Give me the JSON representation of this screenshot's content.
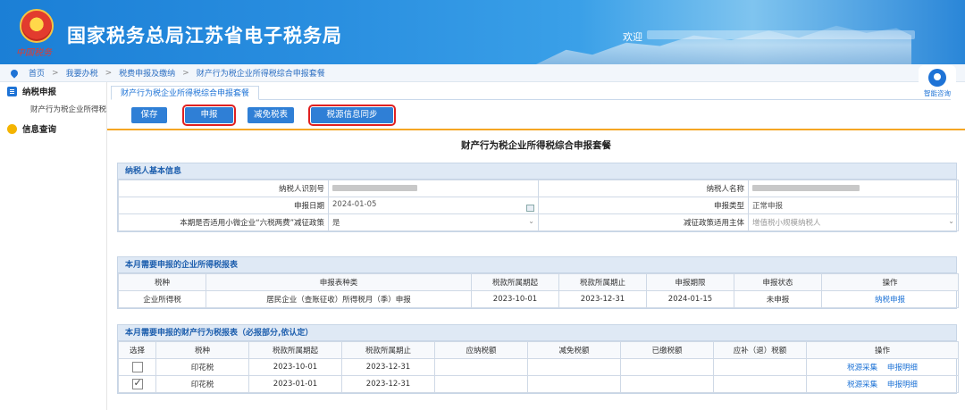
{
  "header": {
    "site_title": "国家税务总局江苏省电子税务局",
    "emblem_text": "中国税务",
    "welcome": "欢迎"
  },
  "breadcrumb": [
    "首页",
    "我要办税",
    "税费申报及缴纳",
    "财产行为税企业所得税综合申报套餐"
  ],
  "sidebar": {
    "group1": "纳税申报",
    "item1": "财产行为税企业所得税",
    "group2": "信息查询"
  },
  "help": {
    "label": "智能咨询"
  },
  "tab": {
    "label": "财产行为税企业所得税综合申报套餐"
  },
  "toolbar": {
    "save": "保存",
    "declare": "申报",
    "reduce": "减免税表",
    "sync": "税源信息同步"
  },
  "main_title": "财产行为税企业所得税综合申报套餐",
  "taxpayer": {
    "section": "纳税人基本信息",
    "id_label": "纳税人识别号",
    "name_label": "纳税人名称",
    "date_label": "申报日期",
    "date_value": "2024-01-05",
    "type_label": "申报类型",
    "type_value": "正常申报",
    "policy_label": "本期是否适用小微企业“六税两费”减征政策",
    "policy_value": "是",
    "subject_label": "减征政策适用主体",
    "subject_value": "增值税小规模纳税人"
  },
  "cit": {
    "section": "本月需要申报的企业所得税报表",
    "headers": [
      "税种",
      "申报表种类",
      "税款所属期起",
      "税款所属期止",
      "申报期限",
      "申报状态",
      "操作"
    ],
    "row": {
      "tax": "企业所得税",
      "form": "居民企业（查账征收）所得税月（季）申报",
      "from": "2023-10-01",
      "to": "2023-12-31",
      "deadline": "2024-01-15",
      "status": "未申报",
      "action": "纳税申报"
    }
  },
  "ppt": {
    "section": "本月需要申报的财产行为税报表（必报部分,依认定）",
    "headers": [
      "选择",
      "税种",
      "税款所属期起",
      "税款所属期止",
      "应纳税额",
      "减免税额",
      "已缴税额",
      "应补（退）税额",
      "操作"
    ],
    "rows": [
      {
        "tax": "印花税",
        "from": "2023-10-01",
        "to": "2023-12-31",
        "checked": false,
        "action1": "税源采集",
        "action2": "申报明细"
      },
      {
        "tax": "印花税",
        "from": "2023-01-01",
        "to": "2023-12-31",
        "checked": true,
        "action1": "税源采集",
        "action2": "申报明细"
      }
    ]
  }
}
